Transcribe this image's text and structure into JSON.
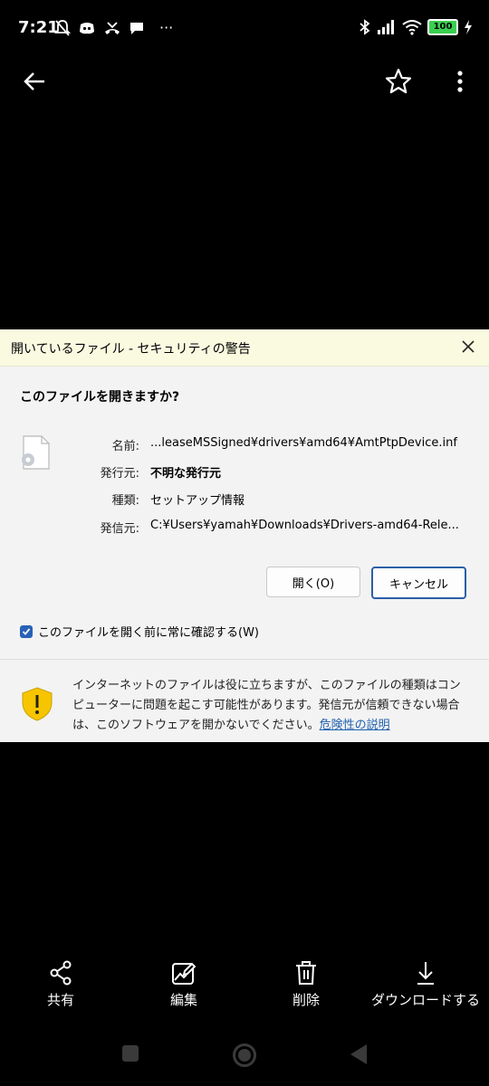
{
  "status_bar": {
    "time": "7:21",
    "more": "···",
    "battery": "100",
    "icons_left": [
      "bell-off-icon",
      "discord-icon",
      "missed-call-icon",
      "chat-bubble-icon"
    ],
    "icons_right": [
      "bluetooth-icon",
      "signal-icon",
      "wifi-icon",
      "battery-icon",
      "charging-icon"
    ]
  },
  "top_bar": {
    "back": "back-arrow-icon",
    "favorite": "star-icon",
    "more": "more-vertical-icon"
  },
  "dialog": {
    "title": "開いているファイル - セキュリティの警告",
    "question": "このファイルを開きますか?",
    "fields": [
      {
        "label": "名前:",
        "value": "...leaseMSSigned¥drivers¥amd64¥AmtPtpDevice.inf",
        "bold": false
      },
      {
        "label": "発行元:",
        "value": "不明な発行元",
        "bold": true
      },
      {
        "label": "種類:",
        "value": "セットアップ情報",
        "bold": false
      },
      {
        "label": "発信元:",
        "value": "C:¥Users¥yamah¥Downloads¥Drivers-amd64-Rele...",
        "bold": false
      }
    ],
    "open_button": "開く(O)",
    "cancel_button": "キャンセル",
    "checkbox_label": "このファイルを開く前に常に確認する(W)",
    "checkbox_checked": true,
    "warning_text": "インターネットのファイルは役に立ちますが、このファイルの種類はコンピューターに問題を起こす可能性があります。発信元が信頼できない場合は、このソフトウェアを開かないでください。",
    "warning_link": "危険性の説明"
  },
  "actions": [
    {
      "label": "共有",
      "icon": "share-icon"
    },
    {
      "label": "編集",
      "icon": "edit-image-icon"
    },
    {
      "label": "削除",
      "icon": "trash-icon"
    },
    {
      "label": "ダウンロードする",
      "icon": "download-icon"
    }
  ],
  "nav_bar": {
    "recents": "recents-square-icon",
    "home": "home-circle-icon",
    "back": "back-triangle-icon"
  }
}
